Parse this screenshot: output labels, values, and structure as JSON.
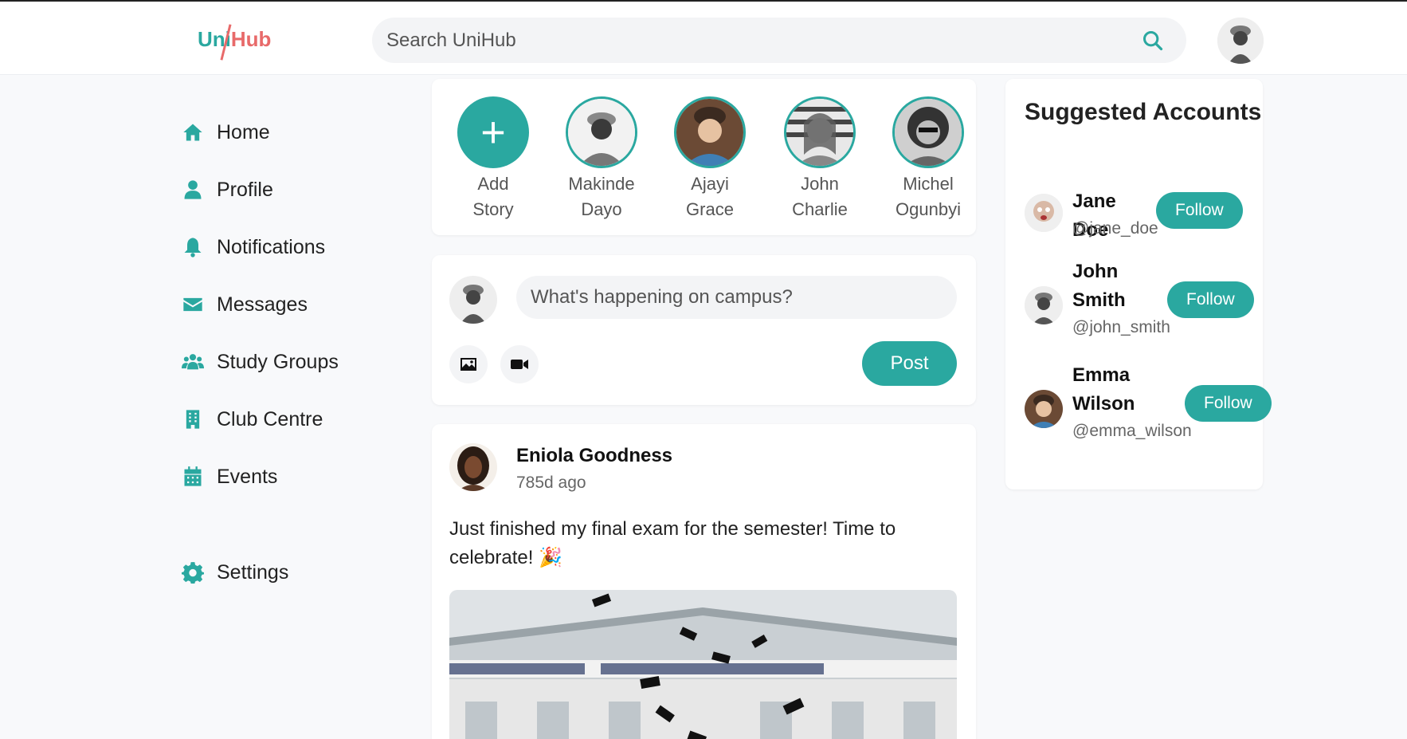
{
  "app": {
    "logo_part1": "Uni",
    "logo_part2": "Hub",
    "accent_color": "#2aa8a0",
    "logo_accent_color": "#e86a6a"
  },
  "search": {
    "placeholder": "Search UniHub",
    "icon": "search-icon"
  },
  "sidebar": {
    "items": [
      {
        "label": "Home",
        "icon": "home-icon"
      },
      {
        "label": "Profile",
        "icon": "user-icon"
      },
      {
        "label": "Notifications",
        "icon": "bell-icon"
      },
      {
        "label": "Messages",
        "icon": "envelope-icon"
      },
      {
        "label": "Study Groups",
        "icon": "users-icon"
      },
      {
        "label": "Club Centre",
        "icon": "building-icon"
      },
      {
        "label": "Events",
        "icon": "calendar-icon"
      }
    ],
    "settings": {
      "label": "Settings",
      "icon": "gear-icon"
    }
  },
  "stories": {
    "add": {
      "line1": "Add",
      "line2": "Story"
    },
    "items": [
      {
        "first": "Makinde",
        "last": "Dayo"
      },
      {
        "first": "Ajayi",
        "last": "Grace"
      },
      {
        "first": "John",
        "last": "Charlie"
      },
      {
        "first": "Michel",
        "last": "Ogunbyi"
      }
    ]
  },
  "composer": {
    "placeholder": "What's happening on campus?",
    "post_label": "Post"
  },
  "post": {
    "author": "Eniola Goodness",
    "time": "785d ago",
    "text": "Just finished my final exam for the semester! Time to celebrate! 🎉"
  },
  "suggested": {
    "title": "Suggested Accounts",
    "accounts": [
      {
        "name": "Jane Doe",
        "handle": "@jane_doe",
        "button": "Follow"
      },
      {
        "name": "John Smith",
        "handle": "@john_smith",
        "button": "Follow"
      },
      {
        "name": "Emma Wilson",
        "handle": "@emma_wilson",
        "button": "Follow"
      }
    ]
  }
}
